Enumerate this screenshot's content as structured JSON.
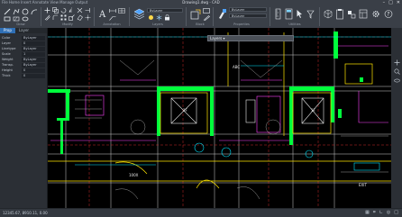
{
  "app": {
    "title": "Drawing1.dwg - CAD",
    "menu": "File  Home  Insert  Annotate  View  Manage  Output"
  },
  "window_controls": {
    "minimize": "–",
    "maximize": "□",
    "close": "✕"
  },
  "ribbon": {
    "groups": [
      "Draw",
      "Modify",
      "Annotation",
      "Layers",
      "Block",
      "Properties",
      "Utilities"
    ],
    "combos": [
      "ByLayer",
      "ByLayer",
      "ByLayer"
    ]
  },
  "panel": {
    "tabs": [
      "Prop",
      "Layer"
    ],
    "rows": [
      {
        "k": "Color",
        "v": "ByLayer"
      },
      {
        "k": "Layer",
        "v": "0"
      },
      {
        "k": "Linetype",
        "v": "ByLayer"
      },
      {
        "k": "Scale",
        "v": "1"
      },
      {
        "k": "Weight",
        "v": "ByLayer"
      },
      {
        "k": "Transp.",
        "v": "ByLayer"
      },
      {
        "k": "Height",
        "v": "0"
      },
      {
        "k": "Thick",
        "v": "0"
      }
    ]
  },
  "canvas": {
    "command_box": "Layers  ▾"
  },
  "status": {
    "coords": "12345.67, 8910.11, 0.00",
    "icons": [
      "grid-icon",
      "snap-icon",
      "ortho-icon",
      "polar-icon",
      "osnap-icon"
    ]
  },
  "colors": {
    "green": "#00ff3c",
    "magenta": "#ff44ff",
    "cyan": "#00e5ff",
    "yellow": "#ffe600",
    "white": "#e8e8e8",
    "red": "#ff3030"
  }
}
